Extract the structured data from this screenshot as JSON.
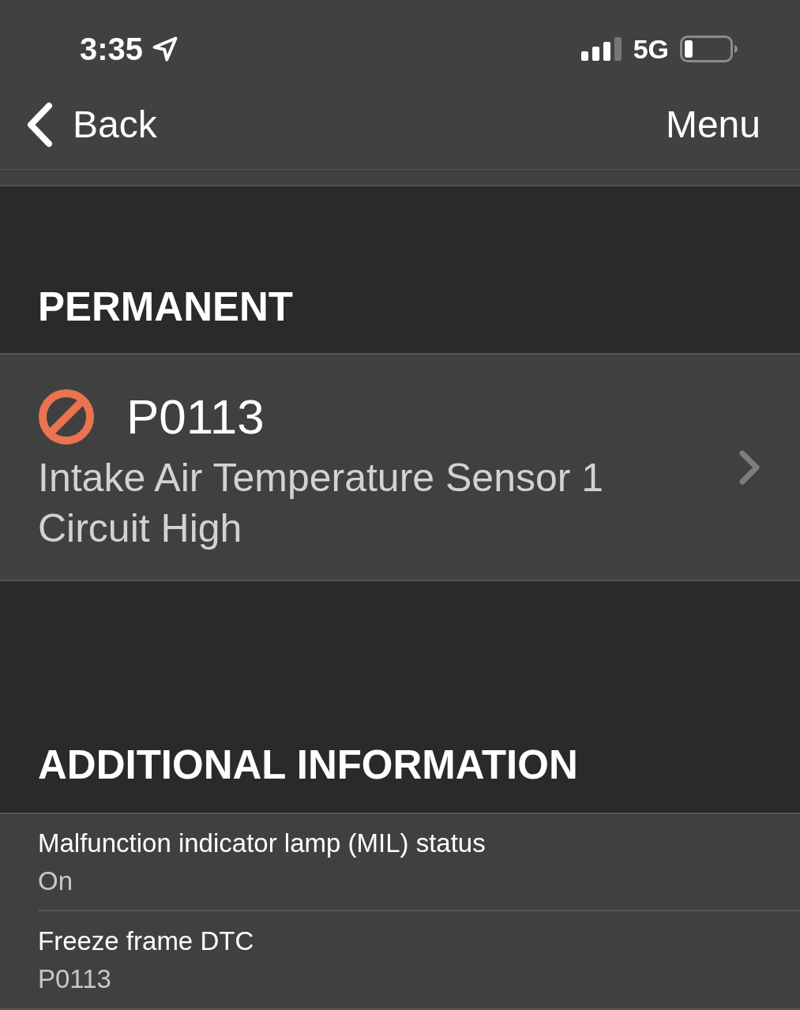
{
  "status_bar": {
    "time": "3:35",
    "network": "5G"
  },
  "nav": {
    "back": "Back",
    "menu": "Menu"
  },
  "sections": [
    {
      "kind": "codes",
      "title": "PERMANENT",
      "items": [
        {
          "code": "P0113",
          "description": "Intake Air Temperature Sensor 1 Circuit High"
        }
      ]
    },
    {
      "kind": "info",
      "title": "ADDITIONAL INFORMATION",
      "items": [
        {
          "label": "Malfunction indicator lamp (MIL) status",
          "value": "On"
        },
        {
          "label": "Freeze frame DTC",
          "value": "P0113"
        }
      ]
    }
  ]
}
